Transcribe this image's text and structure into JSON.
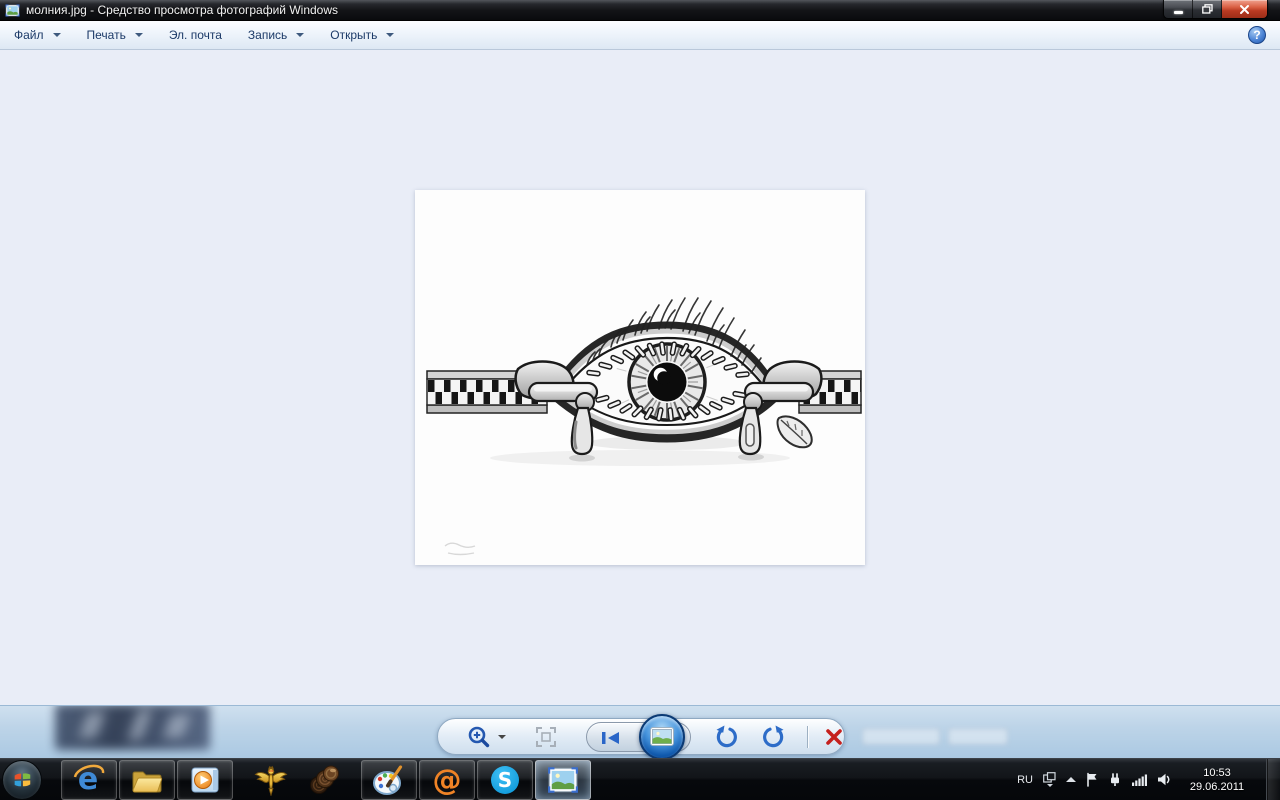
{
  "window": {
    "title": "молния.jpg - Средство просмотра фотографий Windows"
  },
  "menu": {
    "items": [
      {
        "label": "Файл"
      },
      {
        "label": "Печать"
      },
      {
        "label": "Эл. почта"
      },
      {
        "label": "Запись"
      },
      {
        "label": "Открыть"
      }
    ],
    "help_glyph": "?"
  },
  "photo": {
    "description": "Чёрно-белый рисунок: открытый глаз между двумя бегунками расстёгнутой молнии, с листом у правого бегунка"
  },
  "toolbar": {
    "buttons": [
      "zoom",
      "actual-size",
      "previous",
      "slideshow",
      "next",
      "rotate-counterclockwise",
      "rotate-clockwise",
      "delete"
    ]
  },
  "taskbar": {
    "apps": [
      "start",
      "internet-explorer",
      "windows-explorer",
      "media-player",
      "eagle-app",
      "shell-app",
      "paint-app",
      "mailru-agent",
      "skype",
      "photo-viewer"
    ],
    "tray": {
      "language": "RU",
      "time": "10:53",
      "date": "29.06.2011"
    }
  },
  "icons": {
    "ie_letter": "e",
    "mailru_at": "@",
    "skype_letter": "S"
  }
}
